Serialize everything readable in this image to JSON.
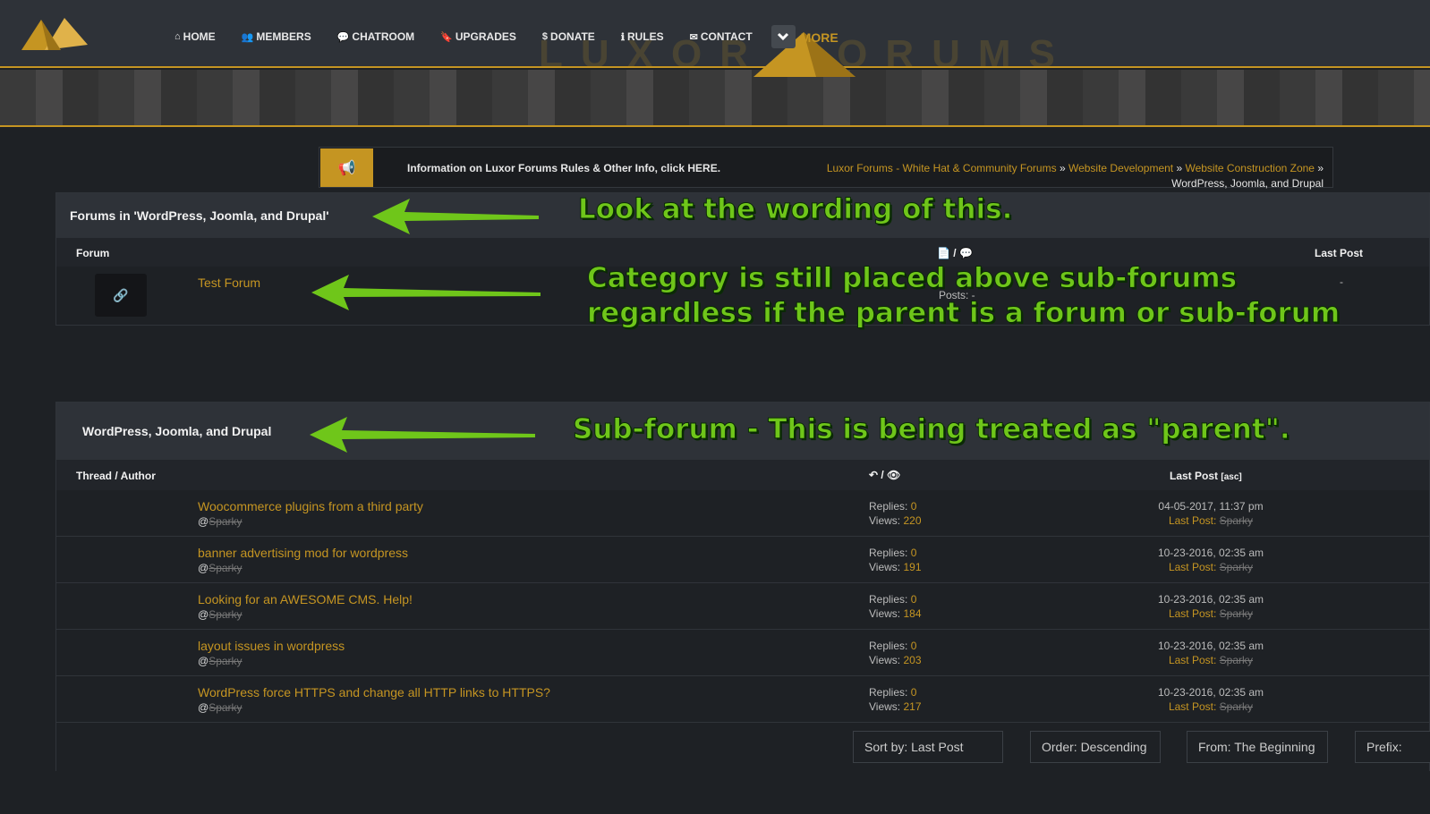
{
  "nav": {
    "items": [
      {
        "icon": "home-icon",
        "glyph": "⌂",
        "label": "HOME"
      },
      {
        "icon": "members-icon",
        "glyph": "👥",
        "label": "MEMBERS"
      },
      {
        "icon": "chat-icon",
        "glyph": "💬",
        "label": "CHATROOM"
      },
      {
        "icon": "bookmark-icon",
        "glyph": "🔖",
        "label": "UPGRADES"
      },
      {
        "icon": "dollar-icon",
        "glyph": "$",
        "label": "DONATE"
      },
      {
        "icon": "info-icon",
        "glyph": "ℹ",
        "label": "RULES"
      },
      {
        "icon": "envelope-icon",
        "glyph": "✉",
        "label": "CONTACT"
      }
    ],
    "more_label": "MORE"
  },
  "brand": {
    "text": "LUXOR  FORUMS"
  },
  "notice": {
    "text": "Information on Luxor Forums Rules & Other Info, click HERE."
  },
  "breadcrumb": {
    "items": [
      "Luxor Forums - White Hat & Community Forums",
      "Website Development",
      "Website Construction Zone"
    ],
    "current": "WordPress, Joomla, and Drupal",
    "sep": " » "
  },
  "forums_panel": {
    "title": "Forums in 'WordPress, Joomla, and Drupal'",
    "col_forum": "Forum",
    "col_sep": "/",
    "col_last": "Last Post",
    "rows": [
      {
        "name": "Test Forum",
        "posts": "Posts: -",
        "last": "-"
      }
    ]
  },
  "threads_panel": {
    "title": "WordPress, Joomla, and Drupal",
    "col_thread": "Thread / Author",
    "col_sep": "/",
    "col_last": "Last Post",
    "col_last_sort": "[asc]",
    "replies_label": "Replies:",
    "views_label": "Views:",
    "lastpost_label": "Last Post:",
    "at": "@",
    "rows": [
      {
        "title": "Woocommerce plugins from a third party",
        "author": "Sparky",
        "replies": "0",
        "views": "220",
        "date": "04-05-2017, 11:37 pm",
        "last_user": "Sparky"
      },
      {
        "title": "banner advertising mod for wordpress",
        "author": "Sparky",
        "replies": "0",
        "views": "191",
        "date": "10-23-2016, 02:35 am",
        "last_user": "Sparky"
      },
      {
        "title": "Looking for an AWESOME CMS. Help!",
        "author": "Sparky",
        "replies": "0",
        "views": "184",
        "date": "10-23-2016, 02:35 am",
        "last_user": "Sparky"
      },
      {
        "title": "layout issues in wordpress",
        "author": "Sparky",
        "replies": "0",
        "views": "203",
        "date": "10-23-2016, 02:35 am",
        "last_user": "Sparky"
      },
      {
        "title": "WordPress force HTTPS and change all HTTP links to HTTPS?",
        "author": "Sparky",
        "replies": "0",
        "views": "217",
        "date": "10-23-2016, 02:35 am",
        "last_user": "Sparky"
      }
    ],
    "sort": {
      "sort_by": "Sort by: Last Post",
      "order": "Order: Descending",
      "from": "From: The Beginning",
      "prefix": "Prefix:"
    }
  },
  "annotations": {
    "a1": "Look at the wording of this.",
    "a2_line1": "Category is still placed above sub-forums",
    "a2_line2": "regardless if the parent is a forum or sub-forum",
    "a3": "Sub-forum - This is being treated as \"parent\"."
  },
  "colors": {
    "accent": "#c59522",
    "annotation": "#6fc61a"
  }
}
